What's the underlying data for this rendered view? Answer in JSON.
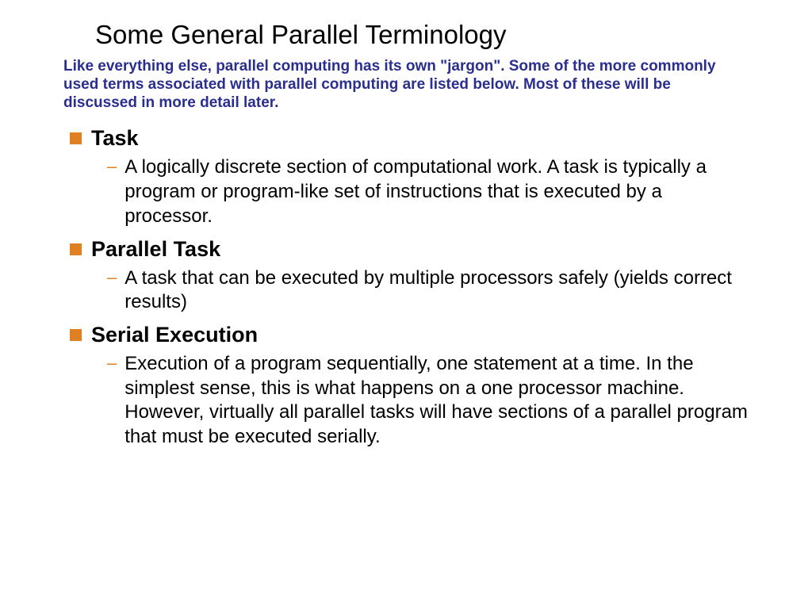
{
  "title": "Some General Parallel Terminology",
  "intro": "Like everything else, parallel computing has its own \"jargon\". Some of the more commonly used terms associated with parallel computing are listed below. Most of these will be discussed in more detail later.",
  "terms": [
    {
      "name": "Task",
      "desc": "A logically discrete section of computational work. A task is typically a program or program-like set of instructions that is executed by a processor."
    },
    {
      "name": "Parallel Task",
      "desc": "A task that can be executed by multiple processors safely (yields correct results)"
    },
    {
      "name": "Serial Execution",
      "desc": "Execution of a program sequentially, one statement at a time. In the simplest sense, this is what happens on a one processor machine. However, virtually all parallel tasks will have sections of a parallel program that must be executed serially."
    }
  ]
}
